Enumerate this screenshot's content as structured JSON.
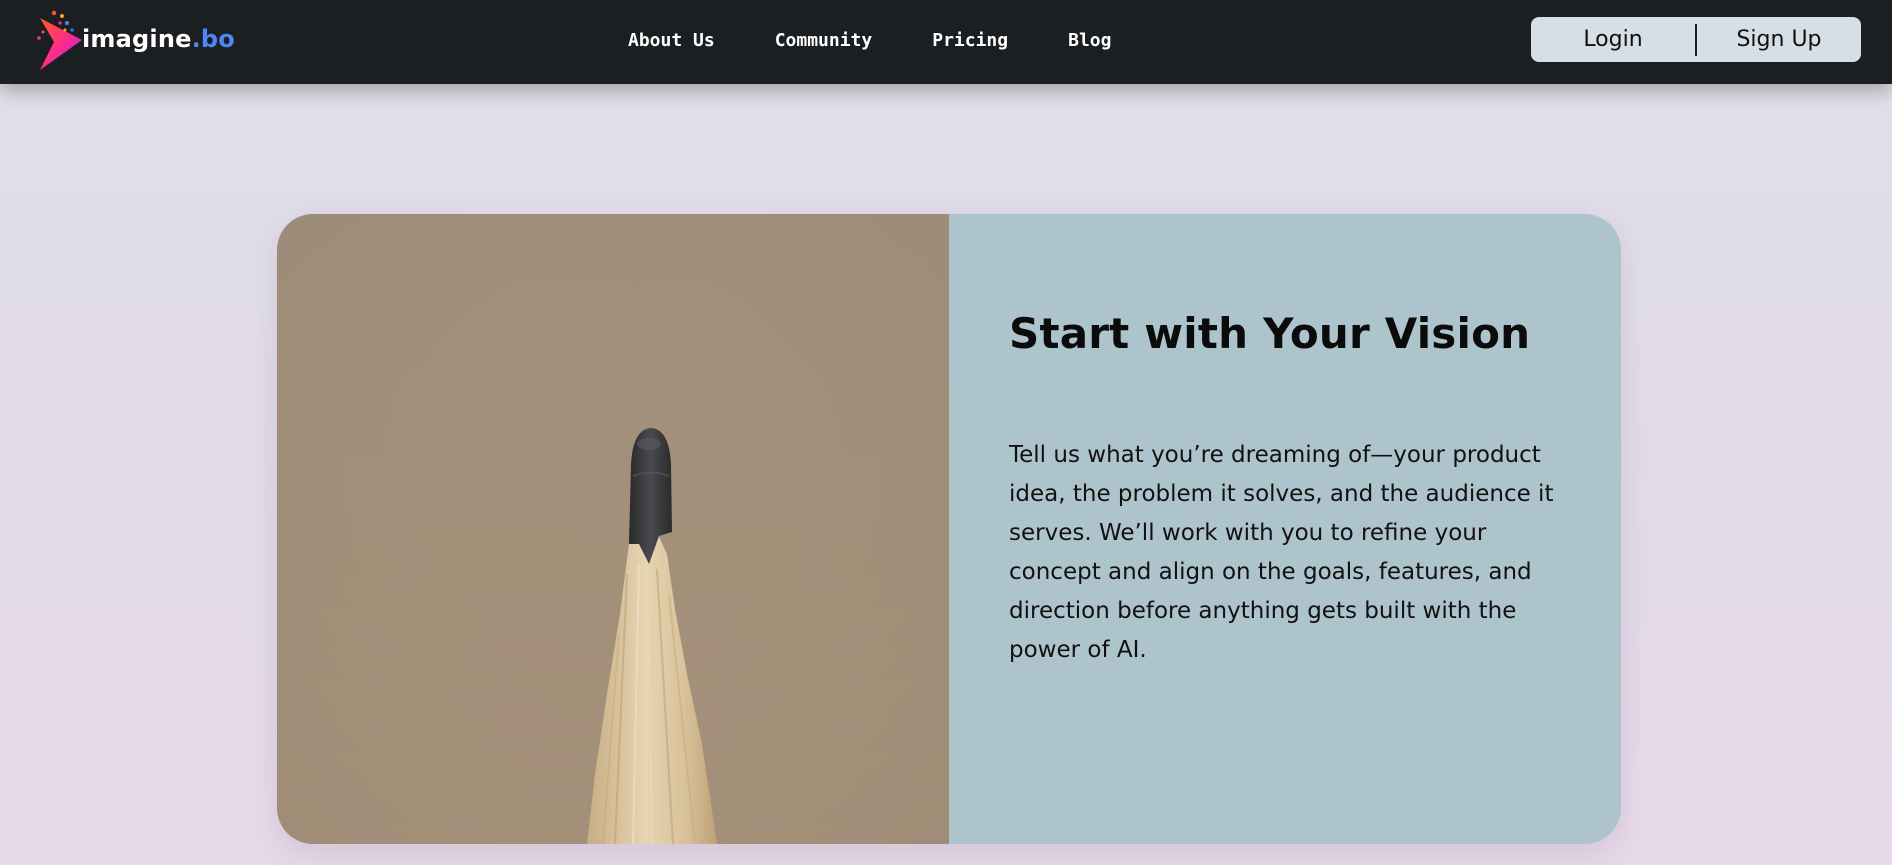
{
  "header": {
    "logo_text": "imagine",
    "logo_suffix": ".bo",
    "nav": [
      {
        "label": "About Us"
      },
      {
        "label": "Community"
      },
      {
        "label": "Pricing"
      },
      {
        "label": "Blog"
      }
    ],
    "login_label": "Login",
    "signup_label": "Sign Up"
  },
  "hero": {
    "title": "Start with Your Vision",
    "body": "Tell us what you’re dreaming of—your product idea, the problem it solves, and the audience it serves. We’ll work with you to refine your concept and align on the goals, features, and direction before anything gets built with the power of AI.",
    "image_icon": "pencil-tip-photo"
  },
  "colors": {
    "navbar": "#1b1f22",
    "auth_bg": "#d5dfe5",
    "card_text_bg": "#aec4cc",
    "card_image_bg": "#a08f7d",
    "page_bg": "#e0dde9"
  }
}
